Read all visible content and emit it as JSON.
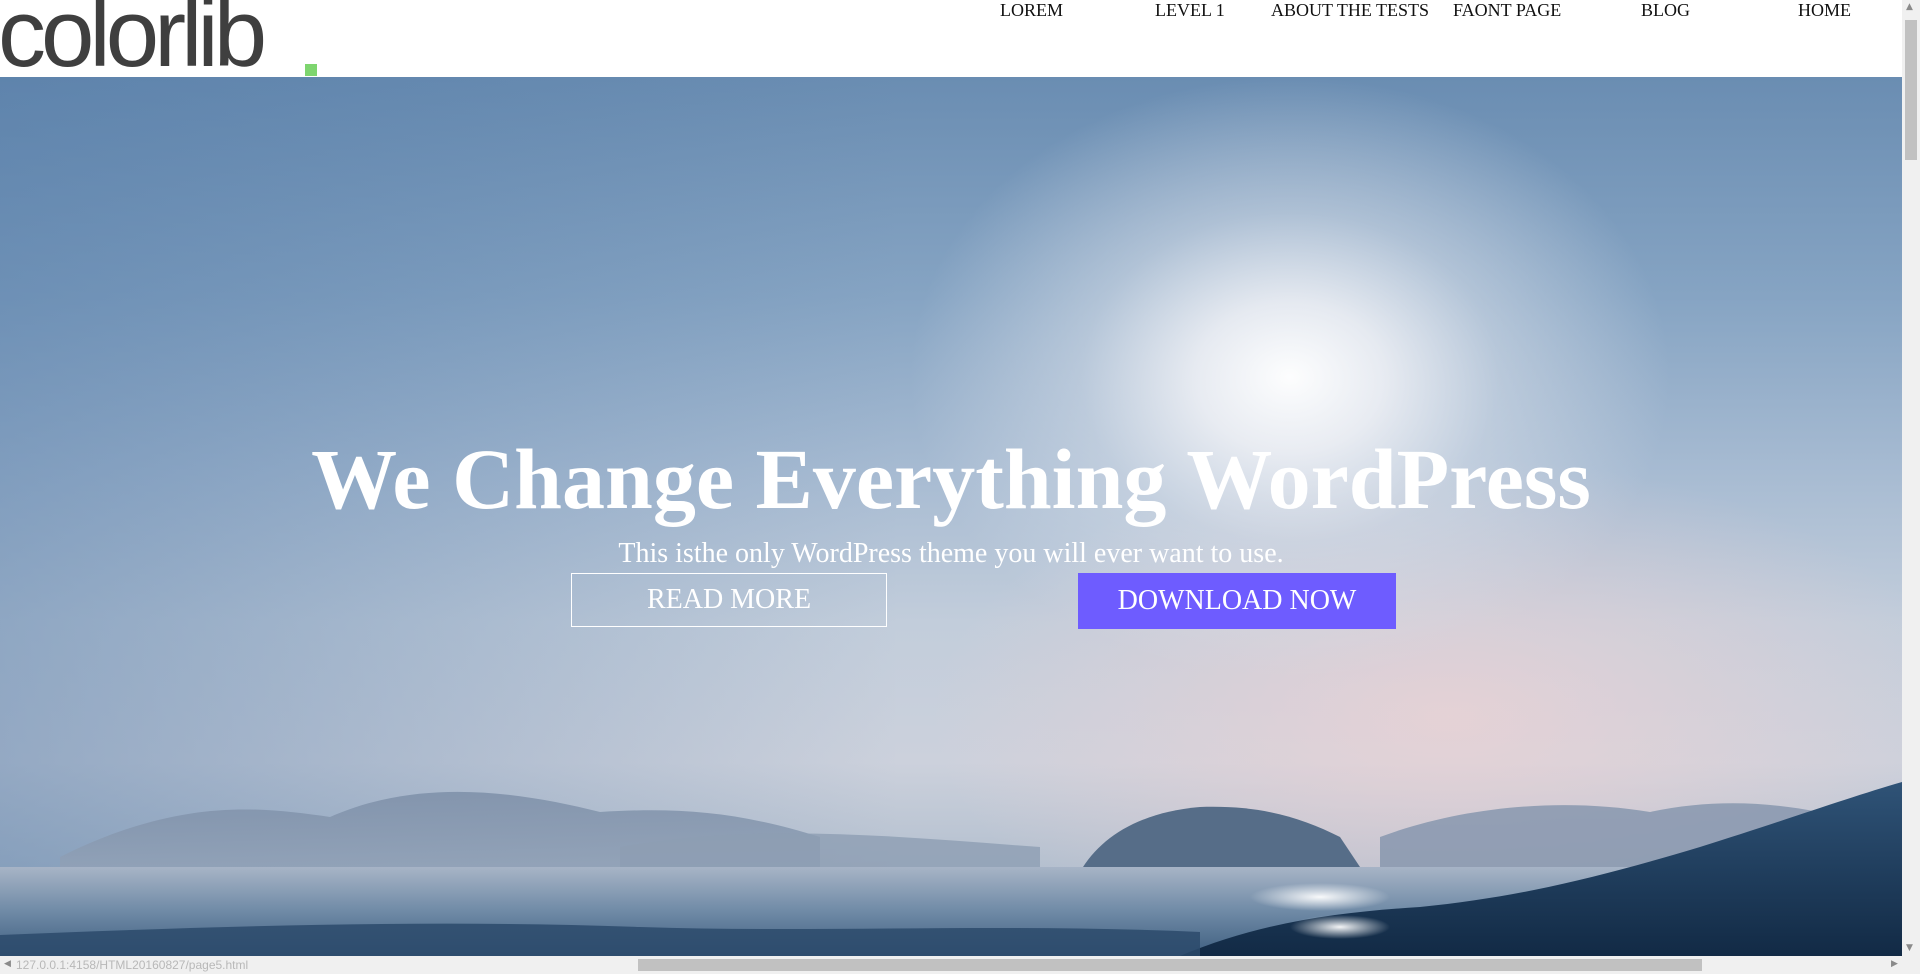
{
  "header": {
    "logo_text": "colorlib",
    "nav": [
      {
        "label": "LOREM"
      },
      {
        "label": "LEVEL 1"
      },
      {
        "label": "ABOUT THE TESTS"
      },
      {
        "label": "FAONT PAGE"
      },
      {
        "label": "BLOG"
      },
      {
        "label": "HOME"
      }
    ]
  },
  "hero": {
    "title": "We Change Everything WordPress",
    "subtitle": "This isthe only WordPress theme you will ever want to use.",
    "read_more_label": "READ MORE",
    "download_label": "DOWNLOAD NOW"
  },
  "status_bar": {
    "url": "127.0.0.1:4158/HTML20160827/page5.html"
  },
  "colors": {
    "logo_text": "#3f3f3f",
    "logo_dot": "#7ed56f",
    "download_button": "#6e5cff",
    "hero_text": "#ffffff"
  }
}
